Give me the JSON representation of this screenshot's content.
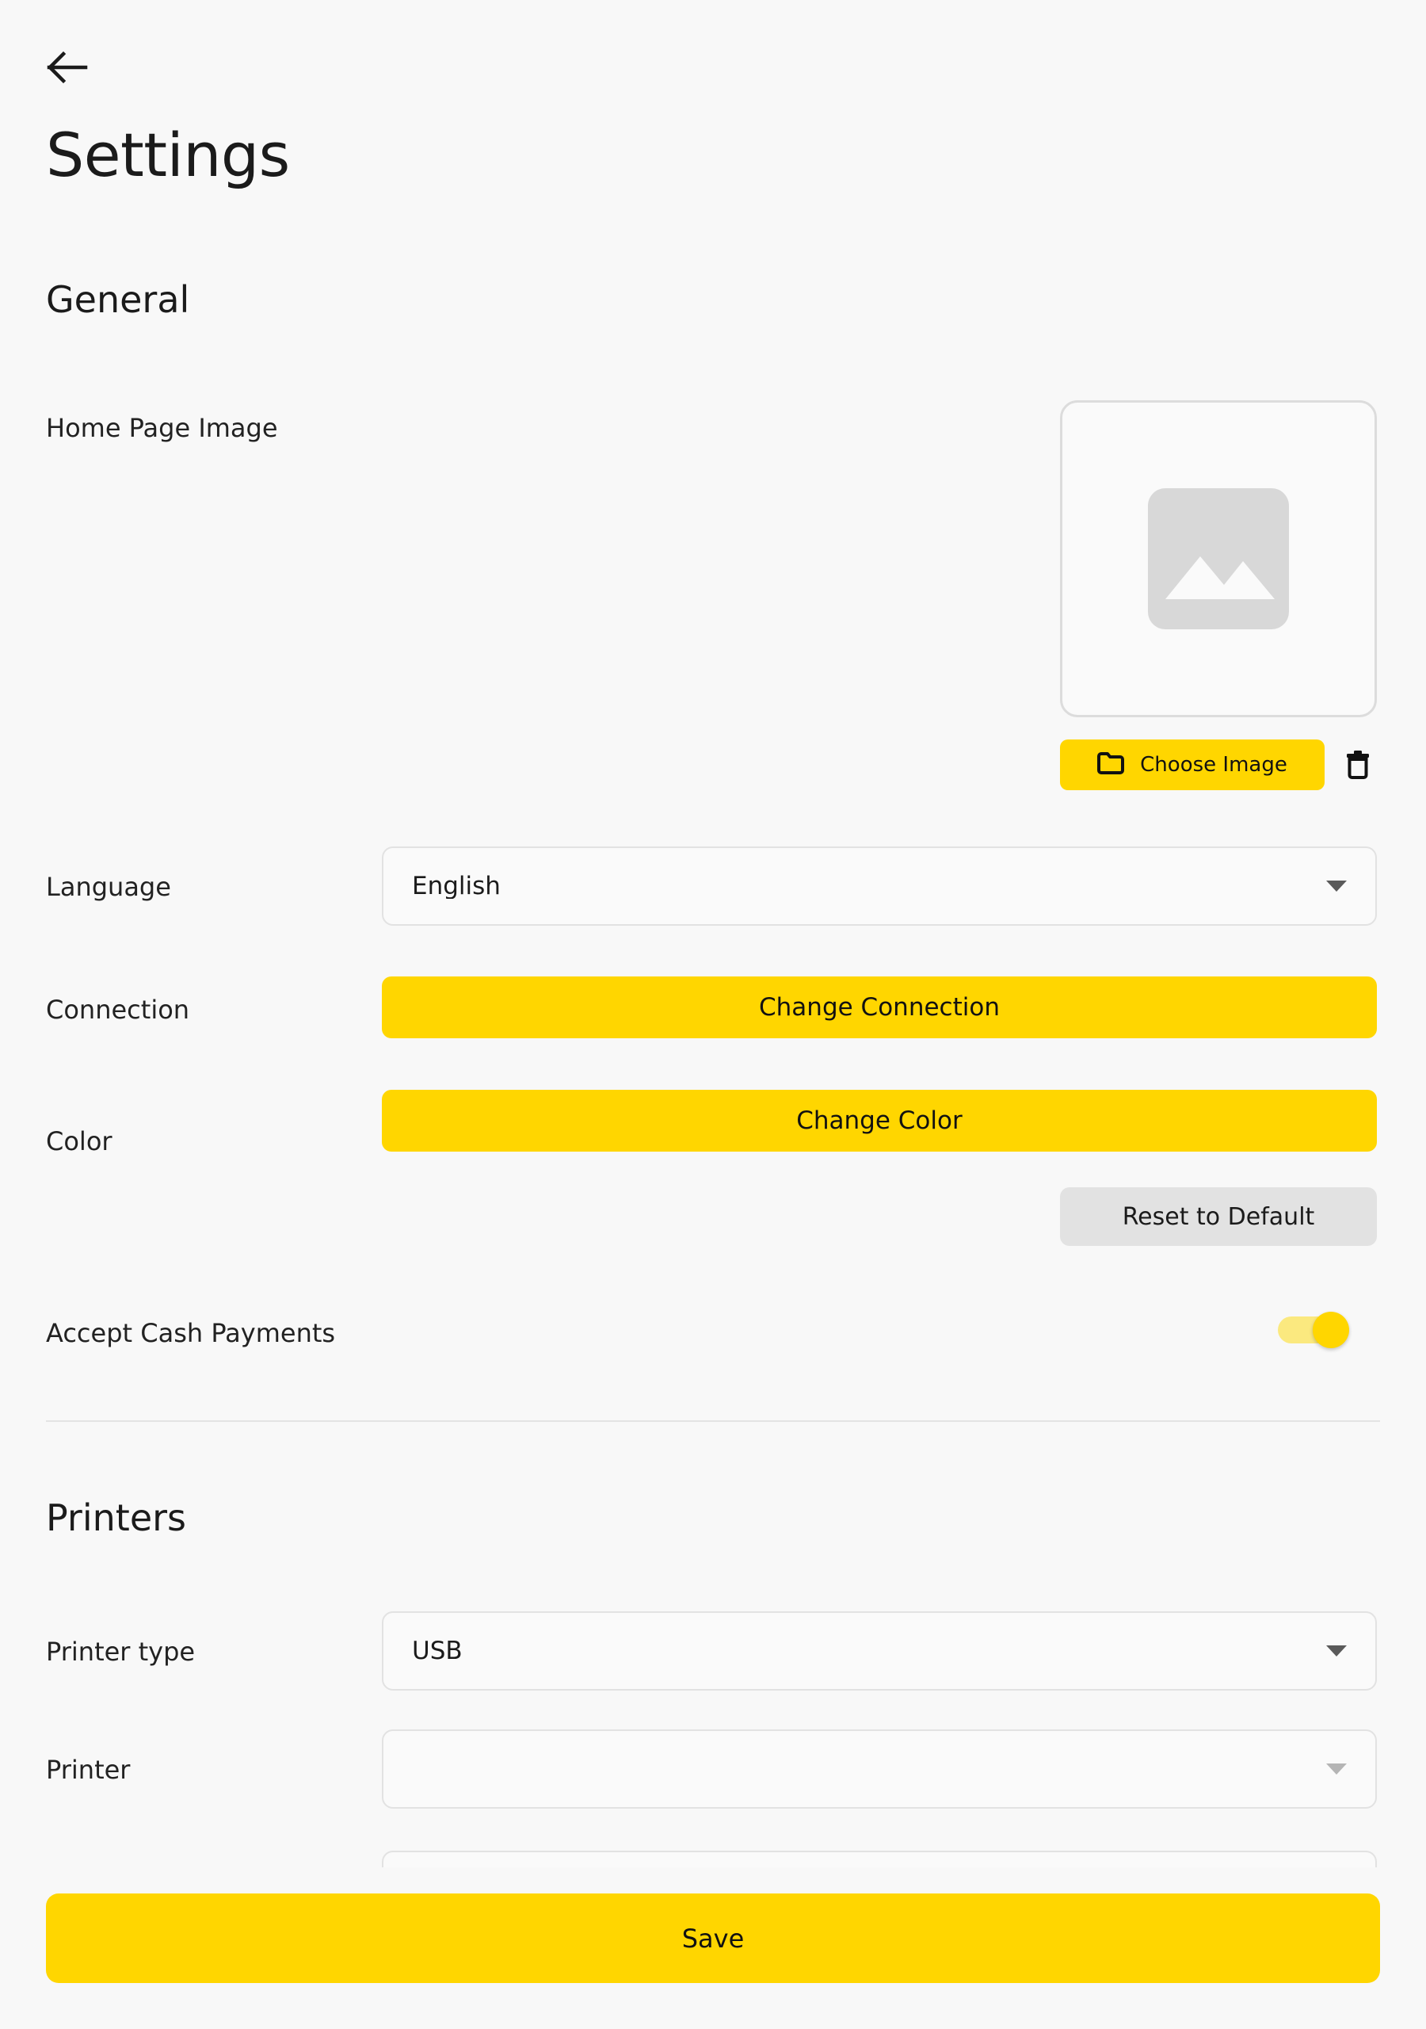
{
  "header": {
    "back_icon": "arrow-left-icon",
    "title": "Settings"
  },
  "sections": {
    "general": {
      "heading": "General",
      "home_page_image": {
        "label": "Home Page Image",
        "preview_icon": "image-placeholder-icon",
        "preview_value": "",
        "choose_button": {
          "label": "Choose Image",
          "icon": "folder-icon"
        },
        "delete_button": {
          "icon": "trash-icon"
        }
      },
      "language": {
        "label": "Language",
        "value": "English",
        "caret_icon": "chevron-down-icon"
      },
      "connection": {
        "label": "Connection",
        "button_label": "Change Connection"
      },
      "color": {
        "label": "Color",
        "button_label": "Change Color",
        "reset_label": "Reset to Default"
      },
      "accept_cash": {
        "label": "Accept Cash Payments",
        "state": "on"
      }
    },
    "printers": {
      "heading": "Printers",
      "printer_type": {
        "label": "Printer type",
        "value": "USB",
        "caret_icon": "chevron-down-icon"
      },
      "printer": {
        "label": "Printer",
        "value": "",
        "caret_icon": "chevron-down-icon"
      }
    }
  },
  "footer": {
    "save_label": "Save"
  },
  "colors": {
    "accent_yellow": "#FFD600",
    "toggle_track": "#FBE97F",
    "background": "#F8F8F8",
    "reset_button": "#E2E2E2",
    "border": "#E2E2E2",
    "placeholder_gray": "#D8D8D8",
    "text_primary": "#1B1B1B"
  }
}
